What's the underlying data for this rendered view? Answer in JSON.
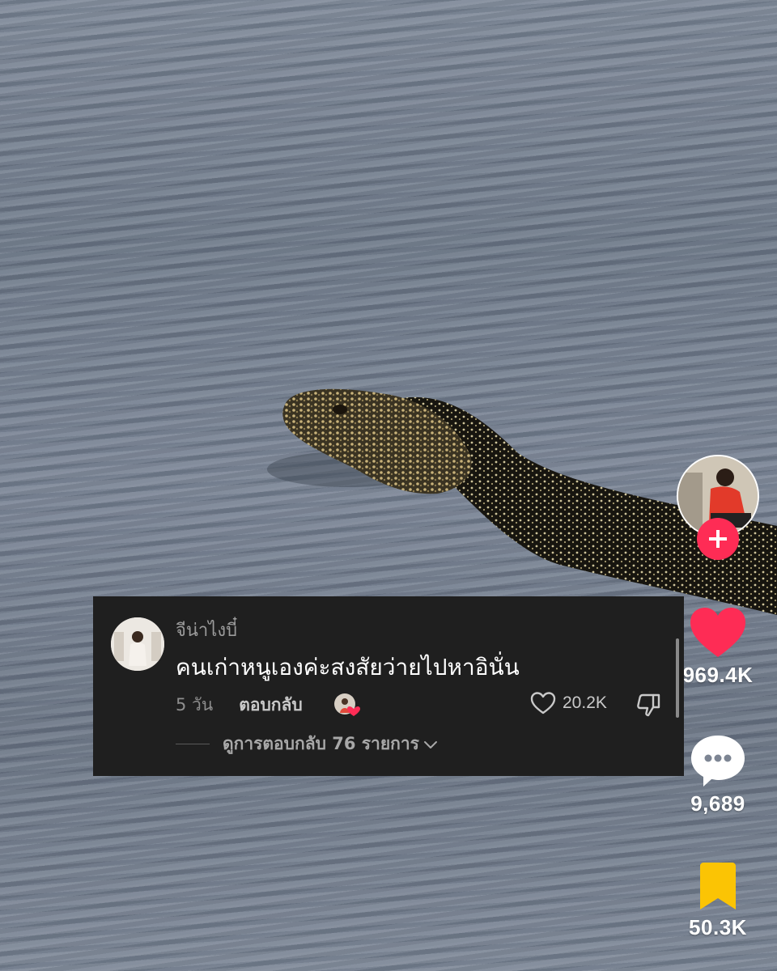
{
  "comment": {
    "username": "จีน่าไงบี๋",
    "text": "คนเก่าหนูเองค่ะสงสัยว่ายไปหาอินั่น",
    "time": "5 วัน",
    "reply_label": "ตอบกลับ",
    "like_count": "20.2K",
    "view_replies": "ดูการตอบกลับ 76 รายการ"
  },
  "rail": {
    "likes": "969.4K",
    "comments": "9,689",
    "saves": "50.3K"
  },
  "colors": {
    "accent": "#fe2c55",
    "save": "#fbc404",
    "card": "#1f1f1f"
  },
  "icons": {
    "follow": "plus-icon",
    "like": "heart-icon",
    "comment": "comment-bubble-icon",
    "save": "bookmark-icon",
    "comment_like": "heart-outline-icon",
    "comment_dislike": "thumbs-down-icon",
    "expand": "chevron-down-icon"
  }
}
